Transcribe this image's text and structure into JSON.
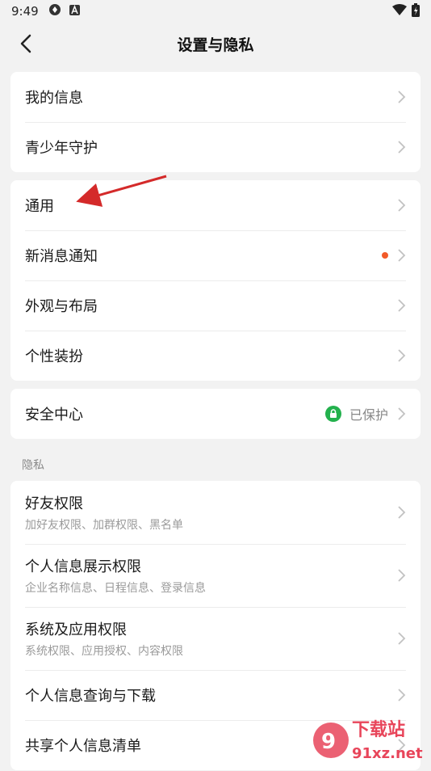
{
  "status_bar": {
    "time": "9:49"
  },
  "header": {
    "title": "设置与隐私"
  },
  "group1": [
    {
      "label": "我的信息"
    },
    {
      "label": "青少年守护"
    }
  ],
  "group2": [
    {
      "label": "通用"
    },
    {
      "label": "新消息通知"
    },
    {
      "label": "外观与布局"
    },
    {
      "label": "个性装扮"
    }
  ],
  "security": {
    "label": "安全中心",
    "status": "已保护"
  },
  "privacy_title": "隐私",
  "privacy": [
    {
      "label": "好友权限",
      "sub": "加好友权限、加群权限、黑名单"
    },
    {
      "label": "个人信息展示权限",
      "sub": "企业名称信息、日程信息、登录信息"
    },
    {
      "label": "系统及应用权限",
      "sub": "系统权限、应用授权、内容权限"
    },
    {
      "label": "个人信息查询与下载"
    },
    {
      "label": "共享个人信息清单"
    }
  ],
  "watermark": {
    "brand": "下载站",
    "domain": "91xz.net"
  },
  "colors": {
    "accent_dot": "#f25a29",
    "secure_green": "#23b14d",
    "annotation_arrow": "#d42a2a"
  }
}
